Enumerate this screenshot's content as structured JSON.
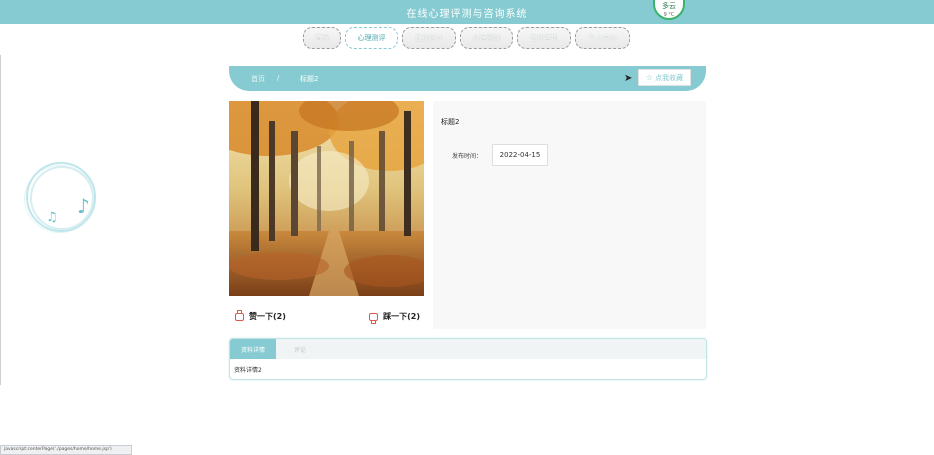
{
  "header": {
    "site_title": "在线心理评测与咨询系统",
    "weather_text": "多云",
    "weather_sub": "9 °C"
  },
  "nav": {
    "items": [
      {
        "label": "首页"
      },
      {
        "label": "心理测评"
      },
      {
        "label": "在线设计"
      },
      {
        "label": "心理测试"
      },
      {
        "label": "在线咨询"
      },
      {
        "label": "个人中心"
      }
    ]
  },
  "breadcrumb": {
    "home": "首页",
    "separator": "/",
    "current": "标题2"
  },
  "actions": {
    "favorite_label": "点我收藏"
  },
  "votes": {
    "up_label": "赞一下(2)",
    "down_label": "踩一下(2)"
  },
  "detail": {
    "title": "标题2",
    "publish_label": "发布时间：",
    "publish_value": "2022-04-15"
  },
  "tabs": {
    "items": [
      {
        "label": "资料详情"
      },
      {
        "label": "评论"
      }
    ],
    "content": "资料详情2"
  },
  "statusbar": {
    "text": "javascript:centerPage('./pages/home/home.jsp')"
  },
  "colors": {
    "accent": "#86cbd1",
    "vote_icon": "#e05a4a"
  }
}
